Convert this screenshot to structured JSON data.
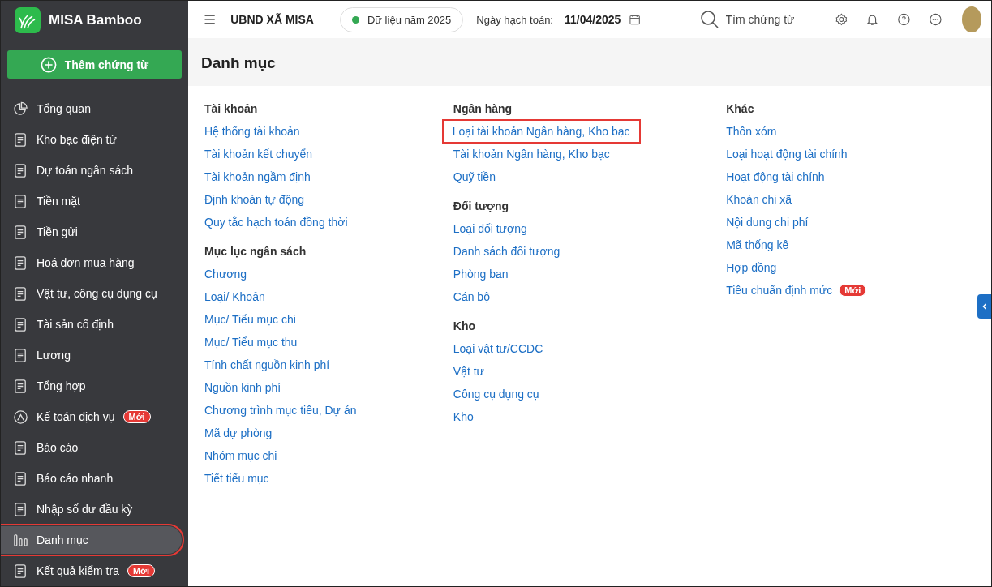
{
  "app": {
    "name": "MISA Bamboo",
    "new_button": "Thêm chứng từ"
  },
  "sidebar": {
    "items": [
      {
        "label": "Tổng quan",
        "selected": false,
        "highlighted": false
      },
      {
        "label": "Kho bạc điện tử",
        "selected": false,
        "highlighted": false
      },
      {
        "label": "Dự toán ngân sách",
        "selected": false,
        "highlighted": false
      },
      {
        "label": "Tiền mặt",
        "selected": false,
        "highlighted": false
      },
      {
        "label": "Tiền gửi",
        "selected": false,
        "highlighted": false
      },
      {
        "label": "Hoá đơn mua hàng",
        "selected": false,
        "highlighted": false
      },
      {
        "label": "Vật tư, công cụ dụng cụ",
        "selected": false,
        "highlighted": false
      },
      {
        "label": "Tài sản cố định",
        "selected": false,
        "highlighted": false
      },
      {
        "label": "Lương",
        "selected": false,
        "highlighted": false
      },
      {
        "label": "Tổng hợp",
        "selected": false,
        "highlighted": false
      },
      {
        "label": "Kế toán dịch vụ",
        "badge": "Mới",
        "selected": false,
        "highlighted": false
      },
      {
        "label": "Báo cáo",
        "selected": false,
        "highlighted": false
      },
      {
        "label": "Báo cáo nhanh",
        "selected": false,
        "highlighted": false
      },
      {
        "label": "Nhập số dư đầu kỳ",
        "selected": false,
        "highlighted": false
      },
      {
        "label": "Danh mục",
        "selected": true,
        "highlighted": true
      },
      {
        "label": "Kết quả kiểm tra",
        "badge": "Mới",
        "selected": false,
        "highlighted": false
      }
    ]
  },
  "topbar": {
    "organization": "UBND XÃ MISA",
    "data_year": "Dữ liệu năm 2025",
    "posting_date_label": "Ngày hạch toán:",
    "posting_date": "11/04/2025",
    "search_placeholder": "Tìm chứng từ"
  },
  "page": {
    "title": "Danh mục",
    "columns": [
      {
        "groups": [
          {
            "title": "Tài khoản",
            "links": [
              {
                "label": "Hệ thống tài khoản",
                "highlighted": false
              },
              {
                "label": "Tài khoản kết chuyển",
                "highlighted": false
              },
              {
                "label": "Tài khoản ngầm định",
                "highlighted": false
              },
              {
                "label": "Định khoản tự động",
                "highlighted": false
              },
              {
                "label": "Quy tắc hạch toán đồng thời",
                "highlighted": false
              }
            ]
          },
          {
            "title": "Mục lục ngân sách",
            "links": [
              {
                "label": "Chương",
                "highlighted": false
              },
              {
                "label": "Loại/ Khoản",
                "highlighted": false
              },
              {
                "label": "Mục/ Tiểu mục chi",
                "highlighted": false
              },
              {
                "label": "Mục/ Tiểu mục thu",
                "highlighted": false
              },
              {
                "label": "Tính chất nguồn kinh phí",
                "highlighted": false
              },
              {
                "label": "Nguồn kinh phí",
                "highlighted": false
              },
              {
                "label": "Chương trình mục tiêu, Dự án",
                "highlighted": false
              },
              {
                "label": "Mã dự phòng",
                "highlighted": false
              },
              {
                "label": "Nhóm mục chi",
                "highlighted": false
              },
              {
                "label": "Tiết tiểu mục",
                "highlighted": false
              }
            ]
          }
        ]
      },
      {
        "groups": [
          {
            "title": "Ngân hàng",
            "links": [
              {
                "label": "Loại tài khoản Ngân hàng, Kho bạc",
                "highlighted": true
              },
              {
                "label": "Tài khoản Ngân hàng, Kho bạc",
                "highlighted": false
              },
              {
                "label": "Quỹ tiền",
                "highlighted": false
              }
            ]
          },
          {
            "title": "Đối tượng",
            "links": [
              {
                "label": "Loại đối tượng",
                "highlighted": false
              },
              {
                "label": "Danh sách đối tượng",
                "highlighted": false
              },
              {
                "label": "Phòng ban",
                "highlighted": false
              },
              {
                "label": "Cán bộ",
                "highlighted": false
              }
            ]
          },
          {
            "title": "Kho",
            "links": [
              {
                "label": "Loại vật tư/CCDC",
                "highlighted": false
              },
              {
                "label": "Vật tư",
                "highlighted": false
              },
              {
                "label": "Công cụ dụng cụ",
                "highlighted": false
              },
              {
                "label": "Kho",
                "highlighted": false
              }
            ]
          }
        ]
      },
      {
        "groups": [
          {
            "title": "Khác",
            "links": [
              {
                "label": "Thôn xóm",
                "highlighted": false
              },
              {
                "label": "Loại hoạt động tài chính",
                "highlighted": false
              },
              {
                "label": "Hoạt động tài chính",
                "highlighted": false
              },
              {
                "label": "Khoản chi xã",
                "highlighted": false
              },
              {
                "label": "Nội dung chi phí",
                "highlighted": false
              },
              {
                "label": "Mã thống kê",
                "highlighted": false
              },
              {
                "label": "Hợp đồng",
                "highlighted": false
              },
              {
                "label": "Tiêu chuẩn định mức",
                "badge": "Mới",
                "highlighted": false
              }
            ]
          }
        ]
      }
    ]
  }
}
